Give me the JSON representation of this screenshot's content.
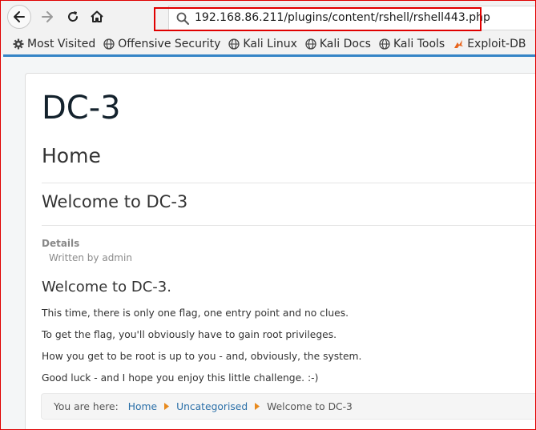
{
  "browser": {
    "url": "192.168.86.211/plugins/content/rshell/rshell443.php",
    "bookmarks": [
      {
        "label": "Most Visited",
        "icon": "gear-icon"
      },
      {
        "label": "Offensive Security",
        "icon": "globe-icon"
      },
      {
        "label": "Kali Linux",
        "icon": "globe-icon"
      },
      {
        "label": "Kali Docs",
        "icon": "globe-icon"
      },
      {
        "label": "Kali Tools",
        "icon": "globe-icon"
      },
      {
        "label": "Exploit-DB",
        "icon": "exploit-db-icon"
      }
    ],
    "colors": {
      "accent": "#3584c6",
      "highlight": "#e00000"
    }
  },
  "page": {
    "site_title": "DC-3",
    "heading": "Home",
    "article_title": "Welcome to DC-3",
    "details_label": "Details",
    "written_by": "Written by admin",
    "body_heading": "Welcome to DC-3.",
    "paragraphs": [
      "This time, there is only one flag, one entry point and no clues.",
      "To get the flag, you'll obviously have to gain root privileges.",
      "How you get to be root is up to you - and, obviously, the system.",
      "Good luck - and I hope you enjoy this little challenge.  :-)"
    ],
    "breadcrumb": {
      "prefix": "You are here:",
      "items": [
        "Home",
        "Uncategorised"
      ],
      "current": "Welcome to DC-3"
    }
  }
}
